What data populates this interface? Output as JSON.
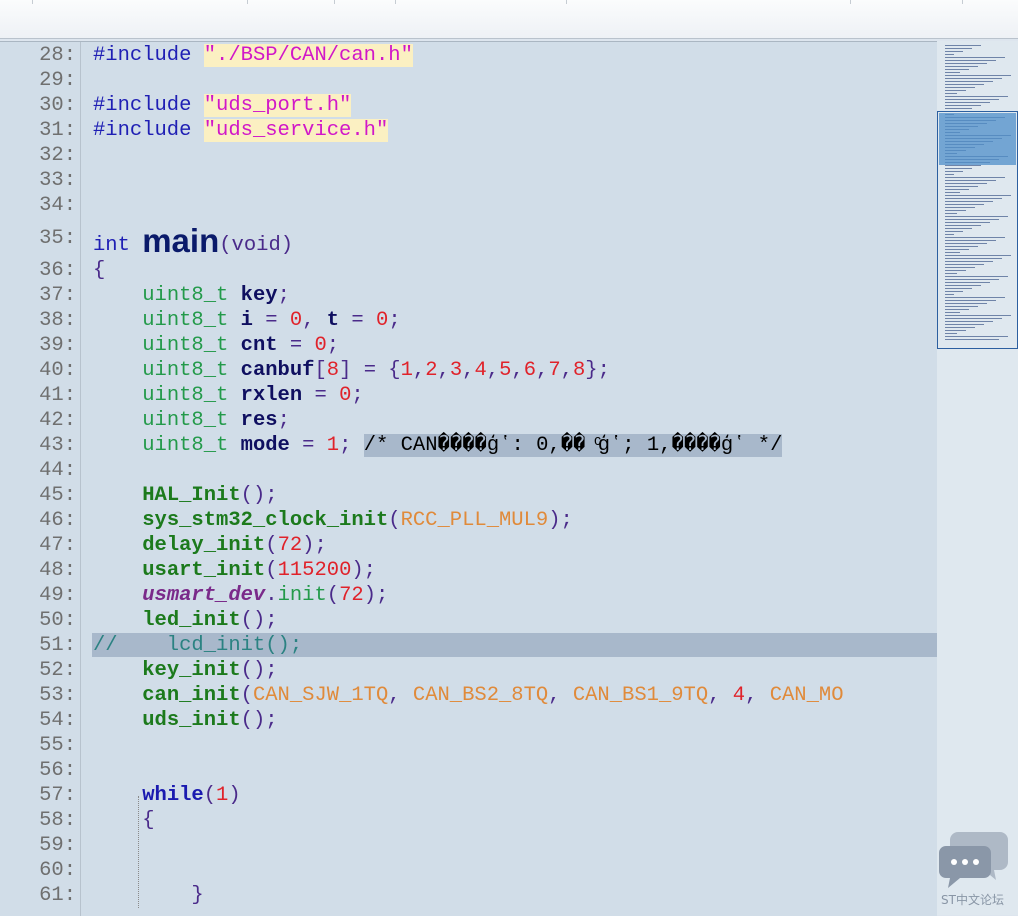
{
  "editor": {
    "lines": [
      {
        "n": "28:",
        "tokens": [
          [
            "kw",
            "#include"
          ],
          [
            "plain",
            " "
          ],
          [
            "str",
            "\"./BSP/CAN/can.h\""
          ]
        ]
      },
      {
        "n": "29:",
        "tokens": []
      },
      {
        "n": "30:",
        "tokens": [
          [
            "kw",
            "#include"
          ],
          [
            "plain",
            " "
          ],
          [
            "str",
            "\"uds_port.h\""
          ]
        ]
      },
      {
        "n": "31:",
        "tokens": [
          [
            "kw",
            "#include"
          ],
          [
            "plain",
            " "
          ],
          [
            "str",
            "\"uds_service.h\""
          ]
        ]
      },
      {
        "n": "32:",
        "tokens": []
      },
      {
        "n": "33:",
        "tokens": []
      },
      {
        "n": "34:",
        "tokens": []
      },
      {
        "n": "35:",
        "tokens": [
          [
            "kw",
            "int"
          ],
          [
            "plain",
            " "
          ],
          [
            "main",
            "main"
          ],
          [
            "punc",
            "(void)"
          ]
        ]
      },
      {
        "n": "36:",
        "tokens": [
          [
            "punc",
            "{"
          ]
        ]
      },
      {
        "n": "37:",
        "tokens": [
          [
            "plain",
            "    "
          ],
          [
            "typ",
            "uint8_t"
          ],
          [
            "plain",
            " "
          ],
          [
            "var",
            "key"
          ],
          [
            "punc",
            ";"
          ]
        ]
      },
      {
        "n": "38:",
        "tokens": [
          [
            "plain",
            "    "
          ],
          [
            "typ",
            "uint8_t"
          ],
          [
            "plain",
            " "
          ],
          [
            "var",
            "i"
          ],
          [
            "punc",
            " = "
          ],
          [
            "num2",
            "0"
          ],
          [
            "punc",
            ", "
          ],
          [
            "var",
            "t"
          ],
          [
            "punc",
            " = "
          ],
          [
            "num2",
            "0"
          ],
          [
            "punc",
            ";"
          ]
        ]
      },
      {
        "n": "39:",
        "tokens": [
          [
            "plain",
            "    "
          ],
          [
            "typ",
            "uint8_t"
          ],
          [
            "plain",
            " "
          ],
          [
            "var",
            "cnt"
          ],
          [
            "punc",
            " = "
          ],
          [
            "num2",
            "0"
          ],
          [
            "punc",
            ";"
          ]
        ]
      },
      {
        "n": "40:",
        "tokens": [
          [
            "plain",
            "    "
          ],
          [
            "typ",
            "uint8_t"
          ],
          [
            "plain",
            " "
          ],
          [
            "var",
            "canbuf"
          ],
          [
            "punc",
            "["
          ],
          [
            "num2",
            "8"
          ],
          [
            "punc",
            "] = {"
          ],
          [
            "num2",
            "1"
          ],
          [
            "punc",
            ","
          ],
          [
            "num2",
            "2"
          ],
          [
            "punc",
            ","
          ],
          [
            "num2",
            "3"
          ],
          [
            "punc",
            ","
          ],
          [
            "num2",
            "4"
          ],
          [
            "punc",
            ","
          ],
          [
            "num2",
            "5"
          ],
          [
            "punc",
            ","
          ],
          [
            "num2",
            "6"
          ],
          [
            "punc",
            ","
          ],
          [
            "num2",
            "7"
          ],
          [
            "punc",
            ","
          ],
          [
            "num2",
            "8"
          ],
          [
            "punc",
            "};"
          ]
        ]
      },
      {
        "n": "41:",
        "tokens": [
          [
            "plain",
            "    "
          ],
          [
            "typ",
            "uint8_t"
          ],
          [
            "plain",
            " "
          ],
          [
            "var",
            "rxlen"
          ],
          [
            "punc",
            " = "
          ],
          [
            "num2",
            "0"
          ],
          [
            "punc",
            ";"
          ]
        ]
      },
      {
        "n": "42:",
        "tokens": [
          [
            "plain",
            "    "
          ],
          [
            "typ",
            "uint8_t"
          ],
          [
            "plain",
            " "
          ],
          [
            "var",
            "res"
          ],
          [
            "punc",
            ";"
          ]
        ]
      },
      {
        "n": "43:",
        "tokens": [
          [
            "plain",
            "    "
          ],
          [
            "typ",
            "uint8_t"
          ],
          [
            "plain",
            " "
          ],
          [
            "var",
            "mode"
          ],
          [
            "punc",
            " = "
          ],
          [
            "num2",
            "1"
          ],
          [
            "punc",
            ";"
          ],
          [
            "plain",
            " "
          ],
          [
            "cmbg",
            "/* CAN����ģʽ: 0,�� ͨģʽ; 1,����ģʽ */"
          ]
        ]
      },
      {
        "n": "44:",
        "tokens": []
      },
      {
        "n": "45:",
        "tokens": [
          [
            "plain",
            "    "
          ],
          [
            "fn",
            "HAL_Init"
          ],
          [
            "punc",
            "();"
          ]
        ]
      },
      {
        "n": "46:",
        "tokens": [
          [
            "plain",
            "    "
          ],
          [
            "fn",
            "sys_stm32_clock_init"
          ],
          [
            "punc",
            "("
          ],
          [
            "mac",
            "RCC_PLL_MUL9"
          ],
          [
            "punc",
            ");"
          ]
        ]
      },
      {
        "n": "47:",
        "tokens": [
          [
            "plain",
            "    "
          ],
          [
            "fn",
            "delay_init"
          ],
          [
            "punc",
            "("
          ],
          [
            "num2",
            "72"
          ],
          [
            "punc",
            ");"
          ]
        ]
      },
      {
        "n": "48:",
        "tokens": [
          [
            "plain",
            "    "
          ],
          [
            "fn",
            "usart_init"
          ],
          [
            "punc",
            "("
          ],
          [
            "num2",
            "115200"
          ],
          [
            "punc",
            ");"
          ]
        ]
      },
      {
        "n": "49:",
        "tokens": [
          [
            "plain",
            "    "
          ],
          [
            "purple",
            "usmart_dev"
          ],
          [
            "punc",
            "."
          ],
          [
            "typ",
            "init"
          ],
          [
            "punc",
            "("
          ],
          [
            "num2",
            "72"
          ],
          [
            "punc",
            ");"
          ]
        ]
      },
      {
        "n": "50:",
        "tokens": [
          [
            "plain",
            "    "
          ],
          [
            "fn",
            "led_init"
          ],
          [
            "punc",
            "();"
          ]
        ]
      },
      {
        "n": "51:",
        "tokens": [
          [
            "cm",
            "//    lcd_init();"
          ]
        ],
        "highlight": true
      },
      {
        "n": "52:",
        "tokens": [
          [
            "plain",
            "    "
          ],
          [
            "fn",
            "key_init"
          ],
          [
            "punc",
            "();"
          ]
        ]
      },
      {
        "n": "53:",
        "tokens": [
          [
            "plain",
            "    "
          ],
          [
            "fn",
            "can_init"
          ],
          [
            "punc",
            "("
          ],
          [
            "mac",
            "CAN_SJW_1TQ"
          ],
          [
            "punc",
            ", "
          ],
          [
            "mac",
            "CAN_BS2_8TQ"
          ],
          [
            "punc",
            ", "
          ],
          [
            "mac",
            "CAN_BS1_9TQ"
          ],
          [
            "punc",
            ", "
          ],
          [
            "num2",
            "4"
          ],
          [
            "punc",
            ", "
          ],
          [
            "mac",
            "CAN_MO"
          ]
        ]
      },
      {
        "n": "54:",
        "tokens": [
          [
            "plain",
            "    "
          ],
          [
            "fn",
            "uds_init"
          ],
          [
            "punc",
            "();"
          ]
        ]
      },
      {
        "n": "55:",
        "tokens": []
      },
      {
        "n": "56:",
        "tokens": []
      },
      {
        "n": "57:",
        "tokens": [
          [
            "plain",
            "    "
          ],
          [
            "while",
            "while"
          ],
          [
            "punc",
            "("
          ],
          [
            "num2",
            "1"
          ],
          [
            "punc",
            ")"
          ]
        ]
      },
      {
        "n": "58:",
        "tokens": [
          [
            "plain",
            "    "
          ],
          [
            "punc",
            "{"
          ]
        ]
      },
      {
        "n": "59:",
        "tokens": []
      },
      {
        "n": "60:",
        "tokens": []
      },
      {
        "n": "61:",
        "tokens": [
          [
            "plain",
            "        "
          ],
          [
            "punc",
            "}"
          ]
        ]
      }
    ]
  },
  "watermark": {
    "text": "ST中文论坛"
  },
  "colors": {
    "background": "#d1dde8",
    "keyword": "#1f1fb4",
    "string": "#d117c8",
    "number": "#e0222a",
    "macro": "#e08a3a",
    "comment": "#2b8282"
  }
}
